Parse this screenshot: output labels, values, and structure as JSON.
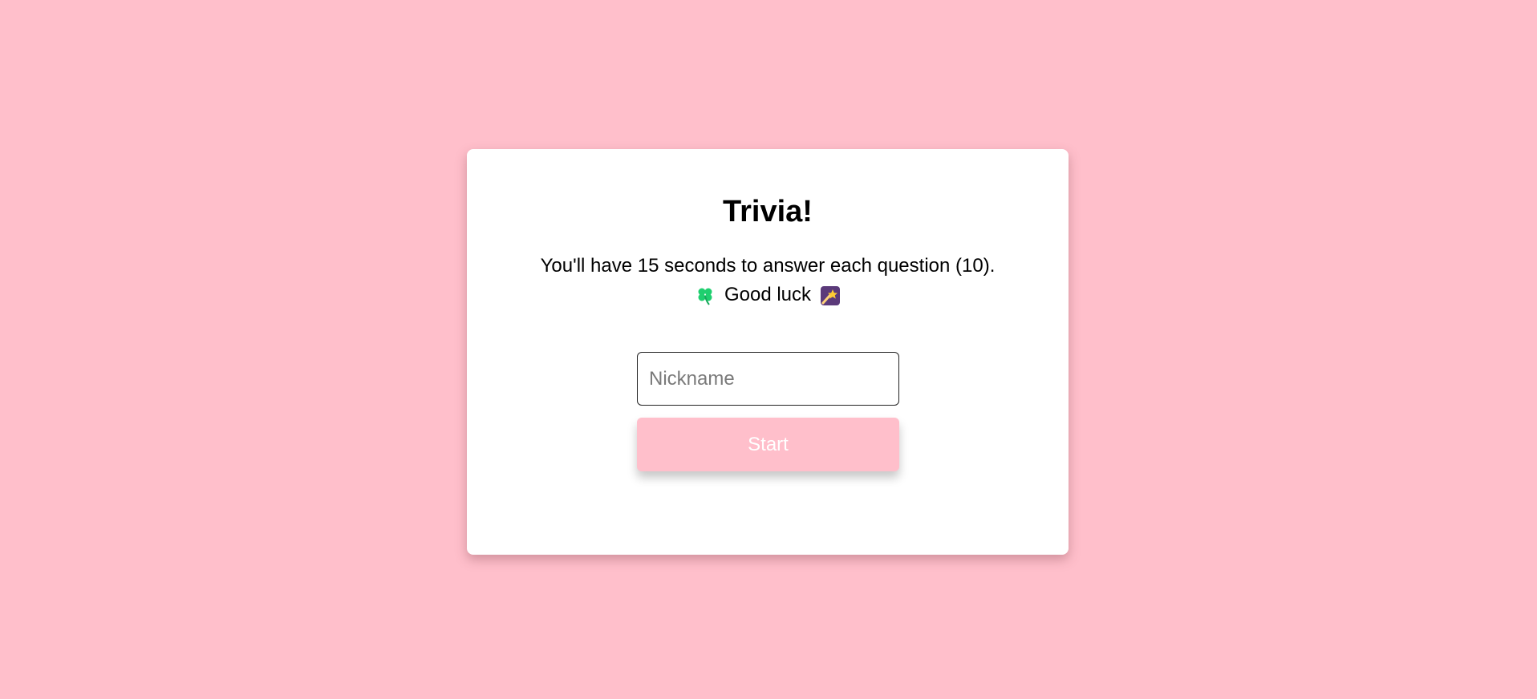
{
  "page": {
    "background_color": "#ffbfcb"
  },
  "card": {
    "title": "Trivia!",
    "instructions": "You'll have 15 seconds to answer each question (10).",
    "luck_text": "Good luck",
    "luck_icons": [
      "four-leaf-clover-icon",
      "shooting-star-icon"
    ]
  },
  "form": {
    "nickname_placeholder": "Nickname",
    "nickname_value": "",
    "start_label": "Start",
    "accent_color": "#ffbfcb"
  }
}
